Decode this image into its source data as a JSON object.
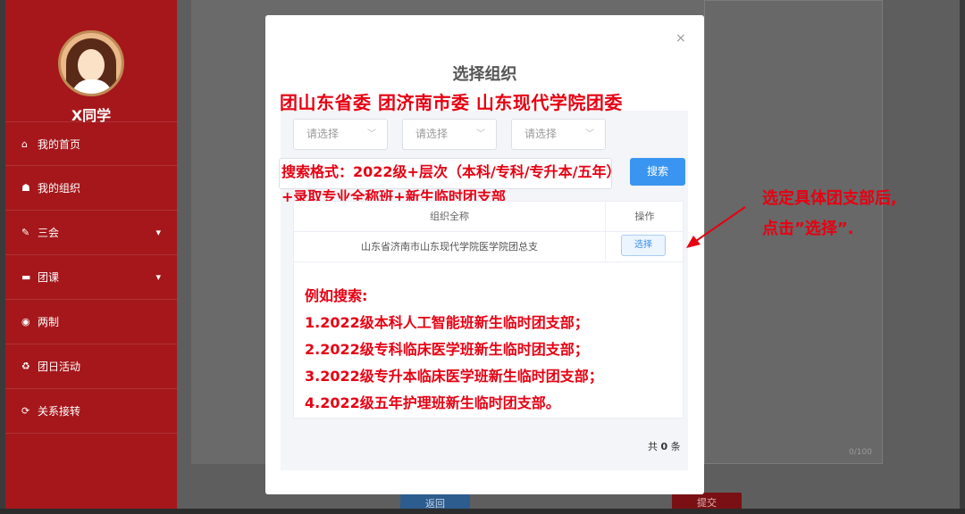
{
  "sidebar": {
    "user_name": "X同学",
    "items": [
      {
        "icon": "home-icon",
        "glyph": "⌂",
        "label": "我的首页",
        "has_chevron": false
      },
      {
        "icon": "group-icon",
        "glyph": "☗",
        "label": "我的组织",
        "has_chevron": false
      },
      {
        "icon": "edit-icon",
        "glyph": "✎",
        "label": "三会",
        "has_chevron": true
      },
      {
        "icon": "folder-icon",
        "glyph": "▬",
        "label": "团课",
        "has_chevron": true
      },
      {
        "icon": "target-icon",
        "glyph": "◉",
        "label": "两制",
        "has_chevron": false
      },
      {
        "icon": "recycle-icon",
        "glyph": "♻",
        "label": "团日活动",
        "has_chevron": false
      },
      {
        "icon": "refresh-icon",
        "glyph": "⟳",
        "label": "关系接转",
        "has_chevron": false
      }
    ]
  },
  "background": {
    "char_count": "0/100",
    "back_label": "返回",
    "submit_label": "提交"
  },
  "modal": {
    "title": "选择组织",
    "close_glyph": "×",
    "red_heading": "团山东省委    团济南市委    山东现代学院团委",
    "selects": [
      {
        "placeholder": "请选择"
      },
      {
        "placeholder": "请选择"
      },
      {
        "placeholder": "请选择"
      }
    ],
    "search_button": "搜索",
    "search_format_line1": "搜索格式：2022级+层次（本科/专科/专升本/五年）",
    "search_format_line2": "+录取专业全称班+新生临时团支部",
    "table": {
      "headers": [
        "组织全称",
        "操作"
      ],
      "rows": [
        {
          "name": "山东省济南市山东现代学院医学院团总支",
          "action": "选择"
        }
      ]
    },
    "examples": [
      "例如搜索:",
      "1.2022级本科人工智能班新生临时团支部；",
      "2.2022级专科临床医学班新生临时团支部；",
      "3.2022级专升本临床医学班新生临时团支部；",
      "4.2022级五年护理班新生临时团支部。"
    ],
    "total_prefix": "共",
    "total_count": "0",
    "total_suffix": "条"
  },
  "annotation": {
    "line1": "选定具体团支部后,",
    "line2": "点击”选择”."
  },
  "colors": {
    "sidebar_red": "#a5171b",
    "annotation_red": "#e60012",
    "primary_blue": "#3a95f0"
  }
}
